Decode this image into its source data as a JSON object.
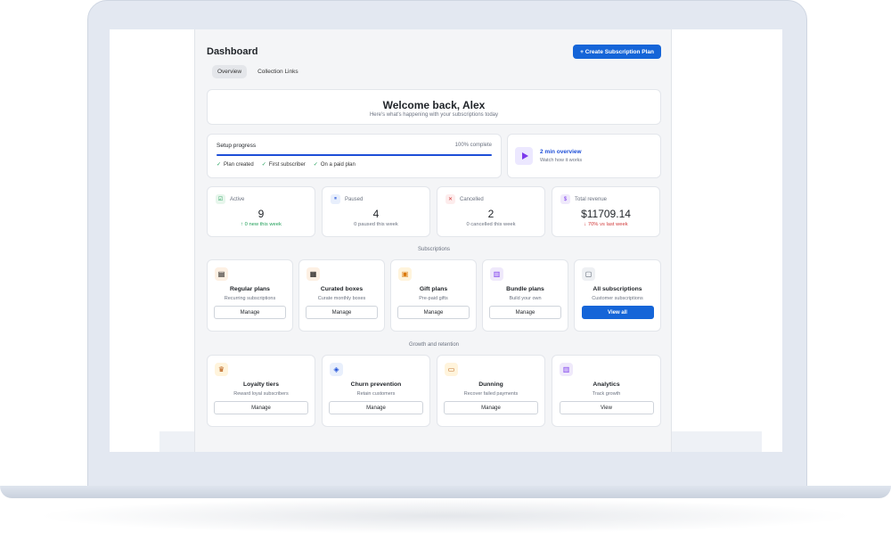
{
  "header": {
    "title": "Dashboard",
    "create_button": "+ Create Subscription Plan"
  },
  "tabs": [
    {
      "label": "Overview",
      "active": true
    },
    {
      "label": "Collection Links",
      "active": false
    }
  ],
  "welcome": {
    "title": "Welcome back, Alex",
    "subtitle": "Here's what's happening with your subscriptions today"
  },
  "setup": {
    "title": "Setup progress",
    "percent_label": "100% complete",
    "progress": 1.0,
    "steps": [
      "Plan created",
      "First subscriber",
      "On a paid plan"
    ]
  },
  "overview_video": {
    "title": "2 min overview",
    "subtitle": "Watch how it works"
  },
  "stats": [
    {
      "label": "Active",
      "value": "9",
      "sub": "↑ 0 new this week",
      "icon": "check-icon",
      "sub_color": "#22a05a"
    },
    {
      "label": "Paused",
      "value": "4",
      "sub": "0 paused this week",
      "icon": "pause-icon",
      "sub_color": "#6b7280"
    },
    {
      "label": "Cancelled",
      "value": "2",
      "sub": "0 cancelled this week",
      "icon": "x-icon",
      "sub_color": "#6b7280"
    },
    {
      "label": "Total revenue",
      "value": "$11709.14",
      "sub": "↓ 70% vs last week",
      "icon": "dollar-icon",
      "sub_color": "#d13b3b"
    }
  ],
  "sections": {
    "subscriptions": "Subscriptions",
    "growth": "Growth and retention"
  },
  "subscription_tiles": [
    {
      "title": "Regular plans",
      "sub": "Recurring subscriptions",
      "button": "Manage",
      "icon": "box-icon",
      "primary": false
    },
    {
      "title": "Curated boxes",
      "sub": "Curate monthly boxes",
      "button": "Manage",
      "icon": "crate-icon",
      "primary": false
    },
    {
      "title": "Gift plans",
      "sub": "Pre-paid gifts",
      "button": "Manage",
      "icon": "gift-icon",
      "primary": false
    },
    {
      "title": "Bundle plans",
      "sub": "Build your own",
      "button": "Manage",
      "icon": "bundle-icon",
      "primary": false
    },
    {
      "title": "All subscriptions",
      "sub": "Customer subscriptions",
      "button": "View all",
      "icon": "clipboard-icon",
      "primary": true
    }
  ],
  "growth_tiles": [
    {
      "title": "Loyalty tiers",
      "sub": "Reward loyal subscribers",
      "button": "Manage",
      "icon": "trophy-icon"
    },
    {
      "title": "Churn prevention",
      "sub": "Retain customers",
      "button": "Manage",
      "icon": "shield-icon"
    },
    {
      "title": "Dunning",
      "sub": "Recover failed payments",
      "button": "Manage",
      "icon": "card-icon"
    },
    {
      "title": "Analytics",
      "sub": "Track growth",
      "button": "View",
      "icon": "chart-icon"
    }
  ],
  "colors": {
    "accent": "#1565d8",
    "positive": "#22a05a",
    "negative": "#d13b3b"
  }
}
